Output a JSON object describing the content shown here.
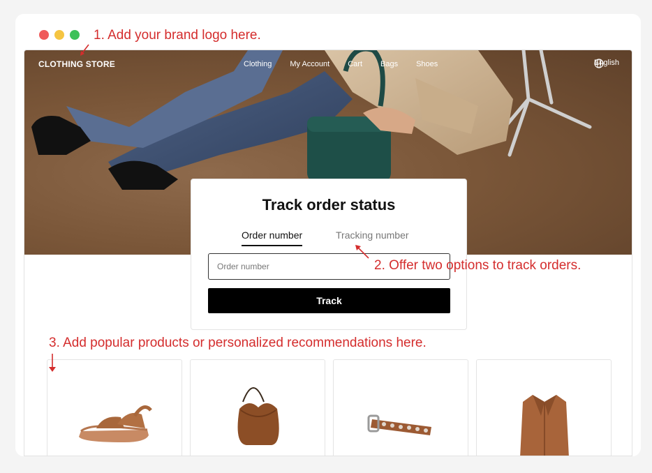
{
  "annotations": {
    "a1": "1. Add your brand logo here.",
    "a2": "2. Offer two options to track orders.",
    "a3": "3. Add popular products or personalized recommendations here.",
    "color": "#d42d2d"
  },
  "nav": {
    "brand": "CLOTHING STORE",
    "links": [
      "Clothing",
      "My Account",
      "Cart",
      "Bags",
      "Shoes"
    ],
    "language": "English"
  },
  "tracker": {
    "title": "Track order status",
    "tabs": [
      "Order number",
      "Tracking number"
    ],
    "active_tab": "Order number",
    "input_placeholder": "Order number",
    "input_value": "",
    "button_label": "Track"
  },
  "products": [
    {
      "icon": "sandal-icon"
    },
    {
      "icon": "handbag-icon"
    },
    {
      "icon": "belt-icon"
    },
    {
      "icon": "jacket-icon"
    }
  ],
  "colors": {
    "window_dots": [
      "#ef5b5b",
      "#f5c542",
      "#3ec15a"
    ],
    "button_bg": "#000000",
    "hero_floor": "#7a5638"
  }
}
